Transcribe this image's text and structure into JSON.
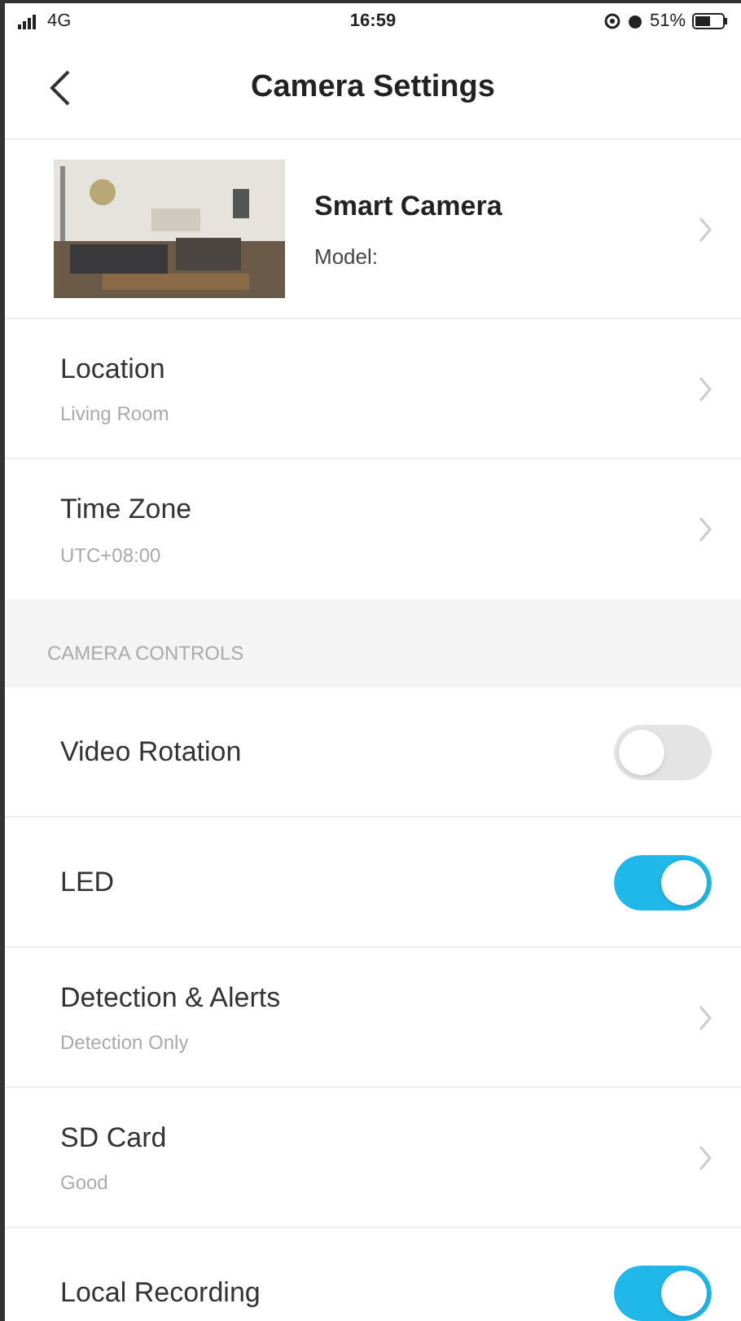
{
  "status_bar": {
    "network": "4G",
    "time": "16:59",
    "battery": "51%"
  },
  "header": {
    "title": "Camera Settings"
  },
  "device": {
    "name": "Smart Camera",
    "model_label": "Model:"
  },
  "settings": [
    {
      "kind": "link",
      "label": "Location",
      "value": "Living Room"
    },
    {
      "kind": "link",
      "label": "Time Zone",
      "value": "UTC+08:00"
    }
  ],
  "section": {
    "title": "CAMERA CONTROLS"
  },
  "controls": [
    {
      "kind": "toggle",
      "label": "Video Rotation",
      "on": false
    },
    {
      "kind": "toggle",
      "label": "LED",
      "on": true
    },
    {
      "kind": "link",
      "label": "Detection & Alerts",
      "value": "Detection Only"
    },
    {
      "kind": "link",
      "label": "SD Card",
      "value": "Good"
    },
    {
      "kind": "toggle",
      "label": "Local Recording",
      "on": true
    }
  ]
}
